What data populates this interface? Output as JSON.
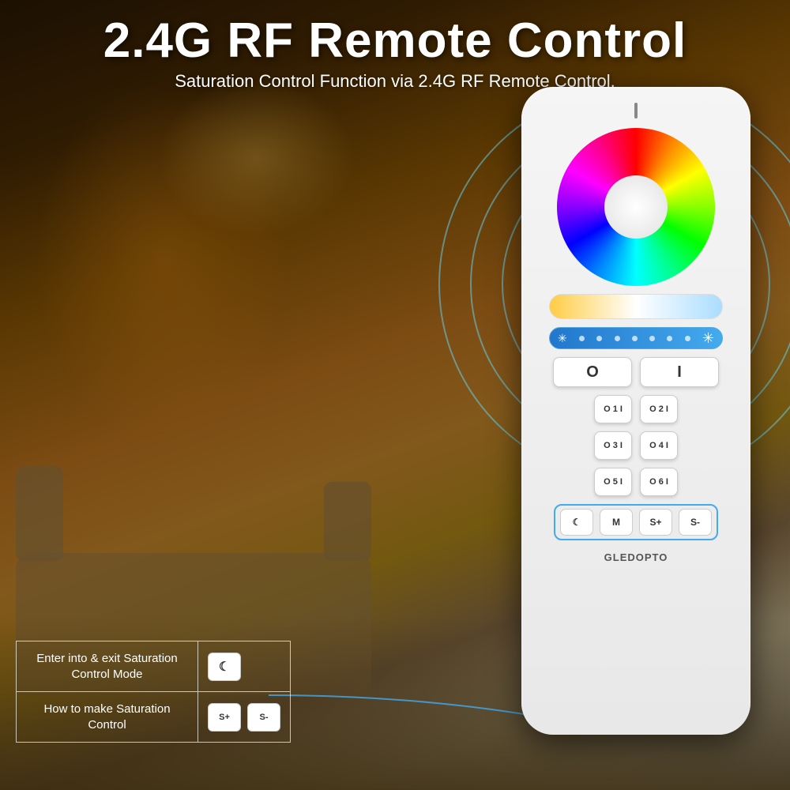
{
  "header": {
    "main_title": "2.4G RF Remote Control",
    "subtitle": "Saturation Control Function via 2.4G RF Remote Control."
  },
  "remote": {
    "color_wheel_label": "RGB Color Wheel",
    "temp_slider_label": "Color Temperature Slider",
    "brightness_slider_label": "Brightness Slider",
    "buttons": {
      "power_on": "O",
      "power_off": "I",
      "zone_rows": [
        [
          "O 1 I",
          "O 2 I"
        ],
        [
          "O 3 I",
          "O 4 I"
        ],
        [
          "O 5 I",
          "O 6 I"
        ]
      ],
      "bottom_row": [
        "☾",
        "M",
        "S+",
        "S-"
      ]
    },
    "brand": "GLEDOPTO"
  },
  "info_panels": [
    {
      "text": "Enter into & exit Saturation Control Mode",
      "button": "☾",
      "button_label": "moon-button"
    },
    {
      "text": "How to make Saturation Control",
      "buttons": [
        "S+",
        "S-"
      ]
    }
  ],
  "ripple_color": "#44ccee",
  "colors": {
    "accent_blue": "#44aaee",
    "white": "#ffffff",
    "text_dark": "#333333"
  }
}
